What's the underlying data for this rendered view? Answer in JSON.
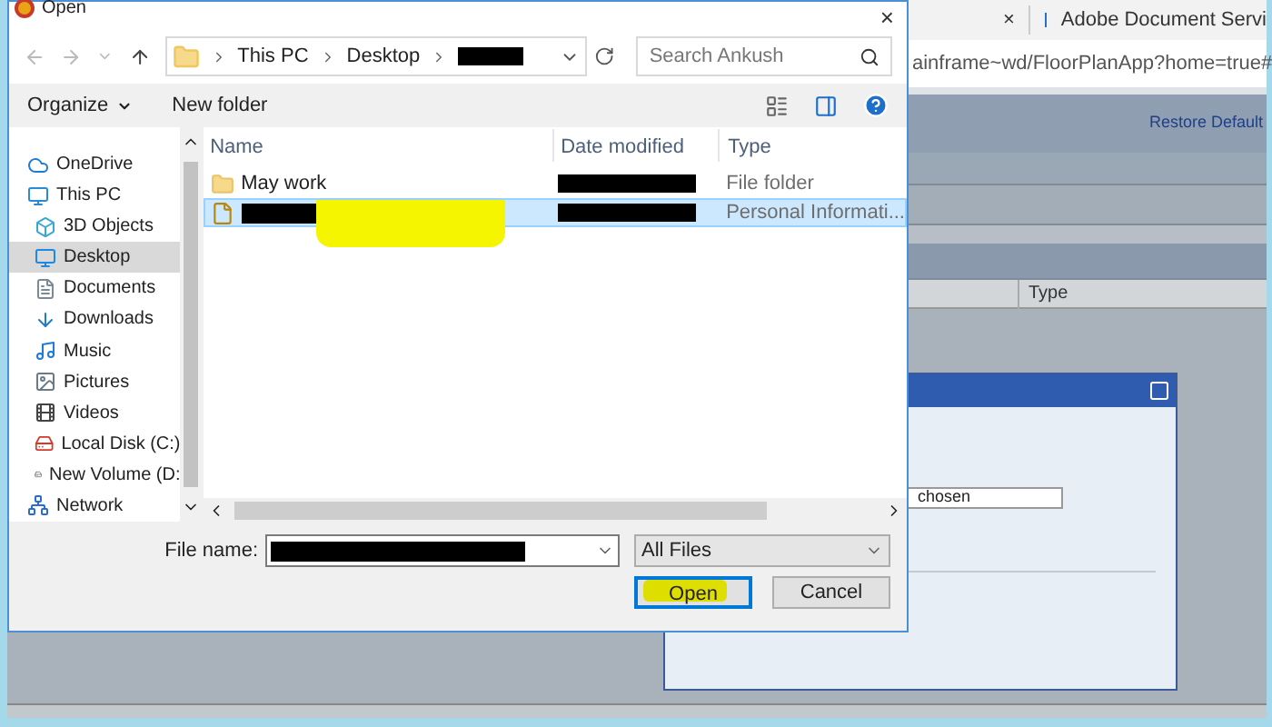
{
  "browser": {
    "tab_close": "×",
    "tab_title": "Adobe Document Servi",
    "address": "ainframe~wd/FloorPlanApp?home=true#",
    "link": "Restore Default",
    "column": "Type",
    "popup": {
      "field_value": "chosen"
    }
  },
  "dialog": {
    "title": "Open",
    "close": "×",
    "breadcrumb": [
      {
        "label": "This PC",
        "redacted": false
      },
      {
        "label": "Desktop",
        "redacted": false
      },
      {
        "redacted": true
      }
    ],
    "search": {
      "placeholder": "Search Ankush"
    },
    "toolbar": [
      "Organize",
      "New folder"
    ],
    "sidebar": [
      {
        "label": "OneDrive",
        "kind": "cloud",
        "selected": false
      },
      {
        "label": "This PC",
        "kind": "pc",
        "selected": false,
        "children": [
          {
            "label": "3D Objects",
            "kind": "cube",
            "selected": false
          },
          {
            "label": "Desktop",
            "kind": "desktop",
            "selected": true
          },
          {
            "label": "Documents",
            "kind": "document",
            "selected": false
          },
          {
            "label": "Downloads",
            "kind": "download",
            "selected": false
          },
          {
            "label": "Music",
            "kind": "music",
            "selected": false
          },
          {
            "label": "Pictures",
            "kind": "picture",
            "selected": false
          },
          {
            "label": "Videos",
            "kind": "video",
            "selected": false
          },
          {
            "label": "Local Disk (C:)",
            "kind": "disk",
            "selected": false
          },
          {
            "label": "New Volume (D:",
            "kind": "drive",
            "selected": false
          }
        ]
      },
      {
        "label": "Network",
        "kind": "network",
        "selected": false
      }
    ],
    "columns": [
      "Name",
      "Date modified",
      "Type"
    ],
    "rows": [
      {
        "kind": "folder",
        "name": "May work",
        "type": "File folder",
        "selected": false
      },
      {
        "kind": "file",
        "type": "Personal Informati...",
        "selected": true
      }
    ],
    "file_name_label": "File name:",
    "filter": "All Files",
    "buttons": [
      {
        "label": "Open",
        "default": true
      },
      {
        "label": "Cancel",
        "default": false
      }
    ]
  }
}
